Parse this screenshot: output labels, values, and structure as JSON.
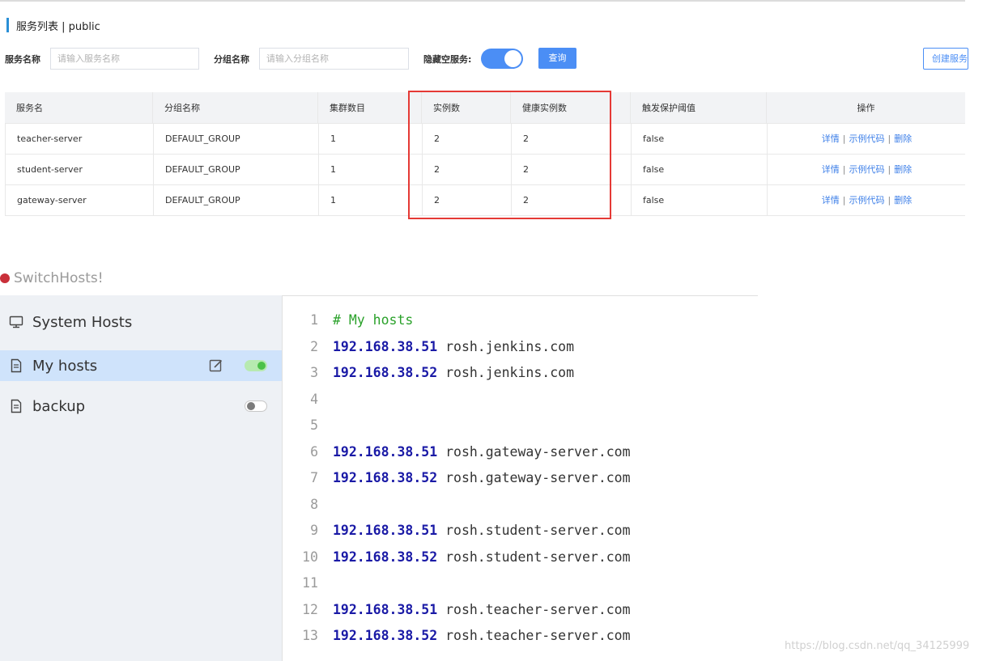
{
  "nacos": {
    "title": "服务列表 | public",
    "filters": {
      "service_label": "服务名称",
      "service_placeholder": "请输入服务名称",
      "group_label": "分组名称",
      "group_placeholder": "请输入分组名称",
      "hide_empty_label": "隐藏空服务:",
      "hide_empty_on": true,
      "query_button": "查询",
      "create_button": "创建服务"
    },
    "table": {
      "headers": [
        "服务名",
        "分组名称",
        "集群数目",
        "实例数",
        "健康实例数",
        "触发保护阈值",
        "操作"
      ],
      "rows": [
        {
          "name": "teacher-server",
          "group": "DEFAULT_GROUP",
          "clusters": "1",
          "instances": "2",
          "healthy": "2",
          "threshold": "false"
        },
        {
          "name": "student-server",
          "group": "DEFAULT_GROUP",
          "clusters": "1",
          "instances": "2",
          "healthy": "2",
          "threshold": "false"
        },
        {
          "name": "gateway-server",
          "group": "DEFAULT_GROUP",
          "clusters": "1",
          "instances": "2",
          "healthy": "2",
          "threshold": "false"
        }
      ],
      "ops": {
        "detail": "详情",
        "sample": "示例代码",
        "delete": "删除",
        "separator": "|"
      }
    },
    "highlight_color": "#e53935"
  },
  "switchhosts": {
    "app_title": "SwitchHosts!",
    "sidebar": [
      {
        "label": "System Hosts",
        "icon": "monitor-icon"
      },
      {
        "label": "My hosts",
        "icon": "file-icon",
        "active": true,
        "enabled": true
      },
      {
        "label": "backup",
        "icon": "file-icon",
        "enabled": false
      }
    ],
    "editor_lines": [
      {
        "n": "1",
        "comment": "# My hosts"
      },
      {
        "n": "2",
        "ip": "192.168.38.51",
        "host": " rosh.jenkins.com"
      },
      {
        "n": "3",
        "ip": "192.168.38.52",
        "host": " rosh.jenkins.com"
      },
      {
        "n": "4"
      },
      {
        "n": "5"
      },
      {
        "n": "6",
        "ip": "192.168.38.51",
        "host": " rosh.gateway-server.com"
      },
      {
        "n": "7",
        "ip": "192.168.38.52",
        "host": " rosh.gateway-server.com"
      },
      {
        "n": "8"
      },
      {
        "n": "9",
        "ip": "192.168.38.51",
        "host": " rosh.student-server.com"
      },
      {
        "n": "10",
        "ip": "192.168.38.52",
        "host": " rosh.student-server.com"
      },
      {
        "n": "11"
      },
      {
        "n": "12",
        "ip": "192.168.38.51",
        "host": " rosh.teacher-server.com"
      },
      {
        "n": "13",
        "ip": "192.168.38.52",
        "host": " rosh.teacher-server.com"
      }
    ]
  },
  "watermark": "https://blog.csdn.net/qq_34125999"
}
